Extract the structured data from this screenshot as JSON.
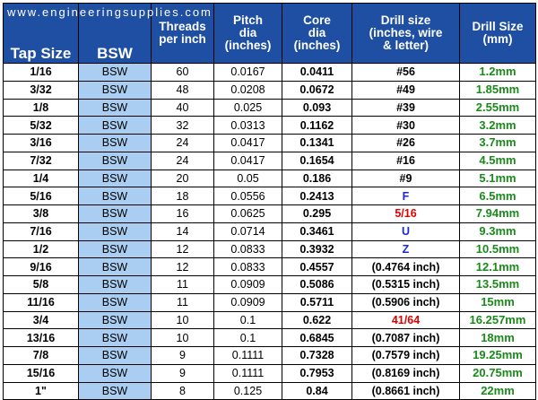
{
  "watermark": "www.engineeringsupplies.com",
  "headers": {
    "tap": "Tap Size",
    "bsw": "BSW",
    "threads_1": "Threads",
    "threads_2": "per inch",
    "pitch_1": "Pitch",
    "pitch_2": "dia",
    "pitch_3": "(inches)",
    "core_1": "Core",
    "core_2": "dia",
    "core_3": "(inches)",
    "drill_1": "Drill size",
    "drill_2": "(inches, wire",
    "drill_3": "& letter)",
    "mm_1": "Drill Size",
    "mm_2": "(mm)"
  },
  "colors": {
    "header_bg": "#1f4fa3",
    "bsw_bg": "#a9cef2",
    "mm_text": "#1a8a1a",
    "drill_red": "#e00000",
    "drill_blue": "#1a2ad8"
  },
  "rows": [
    {
      "tap": "1/16",
      "bsw": "BSW",
      "tpi": "60",
      "pitch": "0.0167",
      "core": "0.0411",
      "drill": "#56",
      "drill_color": "black",
      "mm": "1.2mm"
    },
    {
      "tap": "3/32",
      "bsw": "BSW",
      "tpi": "48",
      "pitch": "0.0208",
      "core": "0.0672",
      "drill": "#49",
      "drill_color": "black",
      "mm": "1.85mm"
    },
    {
      "tap": "1/8",
      "bsw": "BSW",
      "tpi": "40",
      "pitch": "0.025",
      "core": "0.093",
      "drill": "#39",
      "drill_color": "black",
      "mm": "2.55mm"
    },
    {
      "tap": "5/32",
      "bsw": "BSW",
      "tpi": "32",
      "pitch": "0.0313",
      "core": "0.1162",
      "drill": "#30",
      "drill_color": "black",
      "mm": "3.2mm"
    },
    {
      "tap": "3/16",
      "bsw": "BSW",
      "tpi": "24",
      "pitch": "0.0417",
      "core": "0.1341",
      "drill": "#26",
      "drill_color": "black",
      "mm": "3.7mm"
    },
    {
      "tap": "7/32",
      "bsw": "BSW",
      "tpi": "24",
      "pitch": "0.0417",
      "core": "0.1654",
      "drill": "#16",
      "drill_color": "black",
      "mm": "4.5mm"
    },
    {
      "tap": "1/4",
      "bsw": "BSW",
      "tpi": "20",
      "pitch": "0.05",
      "core": "0.186",
      "drill": "#9",
      "drill_color": "black",
      "mm": "5.1mm"
    },
    {
      "tap": "5/16",
      "bsw": "BSW",
      "tpi": "18",
      "pitch": "0.0556",
      "core": "0.2413",
      "drill": "F",
      "drill_color": "blue",
      "mm": "6.5mm"
    },
    {
      "tap": "3/8",
      "bsw": "BSW",
      "tpi": "16",
      "pitch": "0.0625",
      "core": "0.295",
      "drill": "5/16",
      "drill_color": "red",
      "mm": "7.94mm"
    },
    {
      "tap": "7/16",
      "bsw": "BSW",
      "tpi": "14",
      "pitch": "0.0714",
      "core": "0.3461",
      "drill": "U",
      "drill_color": "blue",
      "mm": "9.3mm"
    },
    {
      "tap": "1/2",
      "bsw": "BSW",
      "tpi": "12",
      "pitch": "0.0833",
      "core": "0.3932",
      "drill": "Z",
      "drill_color": "blue",
      "mm": "10.5mm"
    },
    {
      "tap": "9/16",
      "bsw": "BSW",
      "tpi": "12",
      "pitch": "0.0833",
      "core": "0.4557",
      "drill": "(0.4764 inch)",
      "drill_color": "black",
      "mm": "12.1mm"
    },
    {
      "tap": "5/8",
      "bsw": "BSW",
      "tpi": "11",
      "pitch": "0.0909",
      "core": "0.5086",
      "drill": "(0.5315 inch)",
      "drill_color": "black",
      "mm": "13.5mm"
    },
    {
      "tap": "11/16",
      "bsw": "BSW",
      "tpi": "11",
      "pitch": "0.0909",
      "core": "0.5711",
      "drill": "(0.5906 inch)",
      "drill_color": "black",
      "mm": "15mm"
    },
    {
      "tap": "3/4",
      "bsw": "BSW",
      "tpi": "10",
      "pitch": "0.1",
      "core": "0.622",
      "drill": "41/64",
      "drill_color": "red",
      "mm": "16.257mm"
    },
    {
      "tap": "13/16",
      "bsw": "BSW",
      "tpi": "10",
      "pitch": "0.1",
      "core": "0.6845",
      "drill": "(0.7087 inch)",
      "drill_color": "black",
      "mm": "18mm"
    },
    {
      "tap": "7/8",
      "bsw": "BSW",
      "tpi": "9",
      "pitch": "0.1111",
      "core": "0.7328",
      "drill": "(0.7579 inch)",
      "drill_color": "black",
      "mm": "19.25mm"
    },
    {
      "tap": "15/16",
      "bsw": "BSW",
      "tpi": "9",
      "pitch": "0.1111",
      "core": "0.7953",
      "drill": "(0.8169 inch)",
      "drill_color": "black",
      "mm": "20.75mm"
    },
    {
      "tap": "1\"",
      "bsw": "BSW",
      "tpi": "8",
      "pitch": "0.125",
      "core": "0.84",
      "drill": "(0.8661 inch)",
      "drill_color": "black",
      "mm": "22mm"
    }
  ]
}
